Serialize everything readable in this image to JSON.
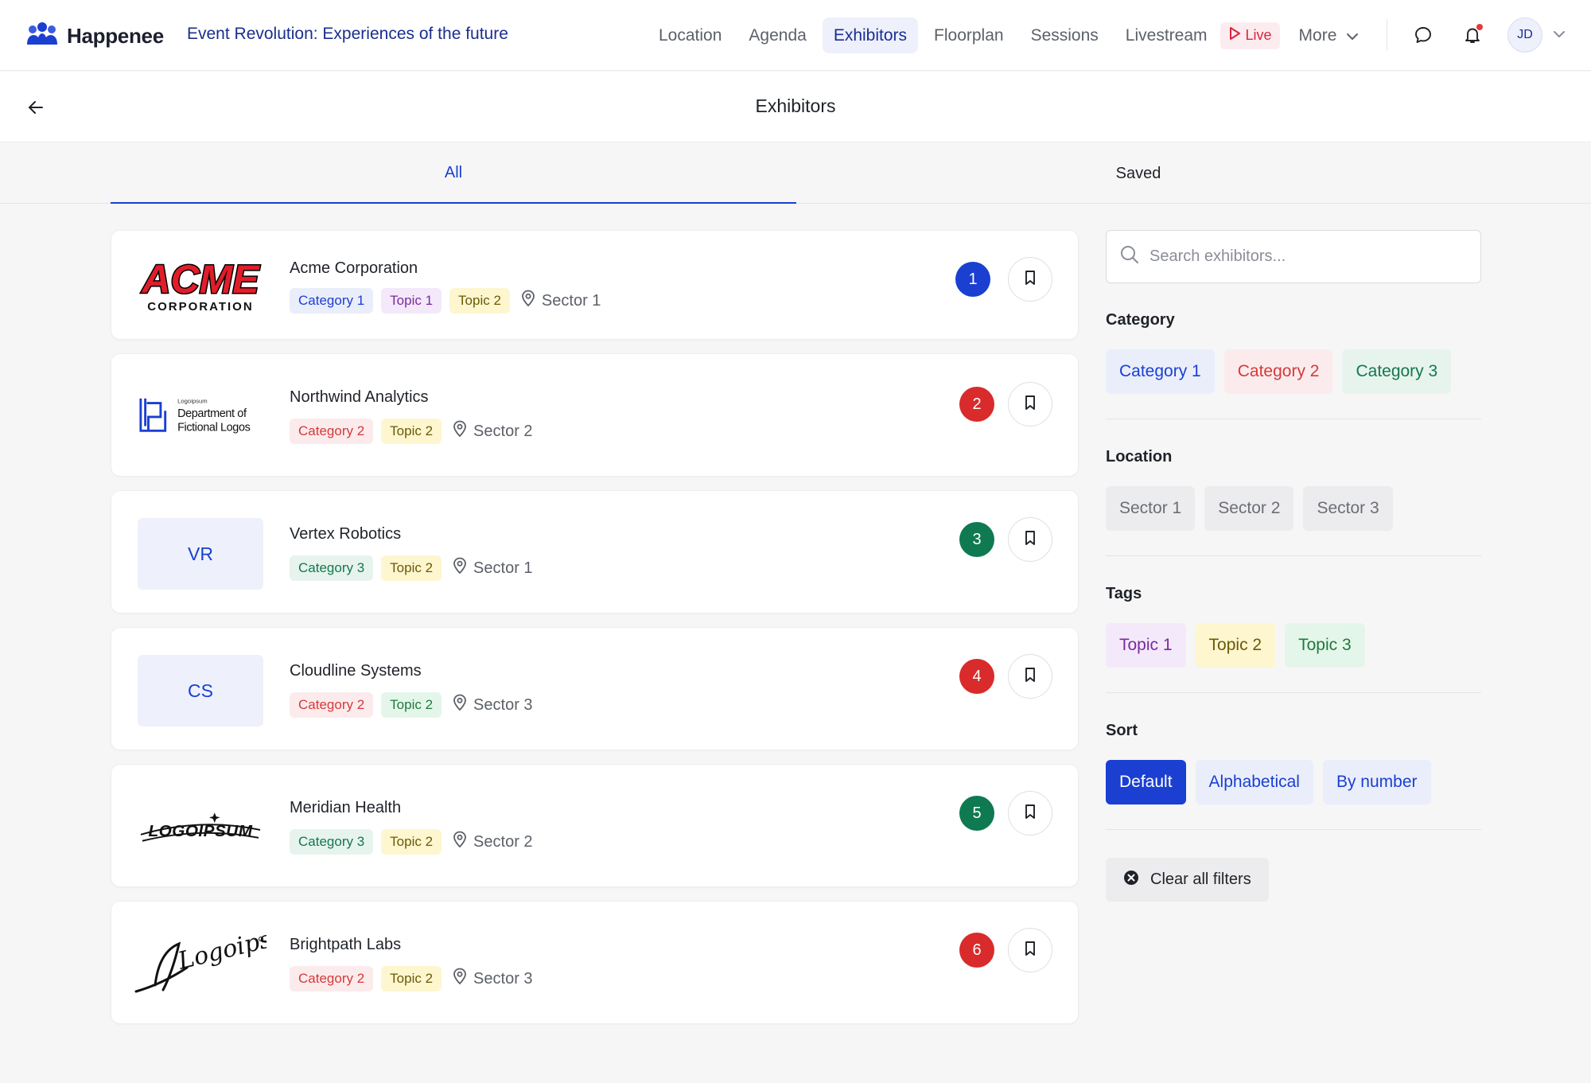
{
  "app": {
    "brand": "Happenee",
    "event_title": "Event Revolution: Experiences of the future"
  },
  "nav": {
    "items": [
      {
        "label": "Location",
        "active": false
      },
      {
        "label": "Agenda",
        "active": false
      },
      {
        "label": "Exhibitors",
        "active": true
      },
      {
        "label": "Floorplan",
        "active": false
      },
      {
        "label": "Sessions",
        "active": false
      },
      {
        "label": "Livestream",
        "active": false
      }
    ],
    "live_label": "Live",
    "more_label": "More"
  },
  "user": {
    "initials": "JD"
  },
  "page": {
    "title": "Exhibitors"
  },
  "tabs": [
    {
      "label": "All",
      "active": true
    },
    {
      "label": "Saved",
      "active": false
    }
  ],
  "exhibitors": [
    {
      "name": "Acme Corporation",
      "number": "1",
      "number_color": "#1a3fd1",
      "logo": {
        "type": "acme",
        "text_top": "ACME",
        "text_bottom": "CORPORATION"
      },
      "tags": [
        {
          "label": "Category 1",
          "kind": "cat1"
        },
        {
          "label": "Topic 1",
          "kind": "top1"
        },
        {
          "label": "Topic 2",
          "kind": "top2"
        }
      ],
      "sector": "Sector 1"
    },
    {
      "name": "Northwind Analytics",
      "number": "2",
      "number_color": "#d92b2b",
      "logo": {
        "type": "dept",
        "text_small": "Logoipsum",
        "text_line1": "Department of",
        "text_line2": "Fictional Logos"
      },
      "tags": [
        {
          "label": "Category 2",
          "kind": "cat2"
        },
        {
          "label": "Topic 2",
          "kind": "top2"
        }
      ],
      "sector": "Sector 2"
    },
    {
      "name": "Vertex Robotics",
      "number": "3",
      "number_color": "#0f7a52",
      "logo": {
        "type": "initials",
        "text": "VR"
      },
      "tags": [
        {
          "label": "Category 3",
          "kind": "cat3"
        },
        {
          "label": "Topic 2",
          "kind": "top2"
        }
      ],
      "sector": "Sector 1"
    },
    {
      "name": "Cloudline Systems",
      "number": "4",
      "number_color": "#d92b2b",
      "logo": {
        "type": "initials",
        "text": "CS"
      },
      "tags": [
        {
          "label": "Category 2",
          "kind": "cat2"
        },
        {
          "label": "Topic 2",
          "kind": "top3"
        }
      ],
      "sector": "Sector 3"
    },
    {
      "name": "Meridian Health",
      "number": "5",
      "number_color": "#0f7a52",
      "logo": {
        "type": "logoipsum",
        "text": "LOGOIPSUM"
      },
      "tags": [
        {
          "label": "Category 3",
          "kind": "cat3"
        },
        {
          "label": "Topic 2",
          "kind": "top2"
        }
      ],
      "sector": "Sector 2"
    },
    {
      "name": "Brightpath Labs",
      "number": "6",
      "number_color": "#d92b2b",
      "logo": {
        "type": "script",
        "text": "Logoipsum"
      },
      "tags": [
        {
          "label": "Category 2",
          "kind": "cat2"
        },
        {
          "label": "Topic 2",
          "kind": "top2"
        }
      ],
      "sector": "Sector 3"
    }
  ],
  "sidebar": {
    "search_placeholder": "Search exhibitors...",
    "category": {
      "title": "Category",
      "chips": [
        {
          "label": "Category 1",
          "kind": "cat1"
        },
        {
          "label": "Category 2",
          "kind": "cat2"
        },
        {
          "label": "Category 3",
          "kind": "cat3"
        }
      ]
    },
    "location": {
      "title": "Location",
      "chips": [
        {
          "label": "Sector 1",
          "kind": "loc"
        },
        {
          "label": "Sector 2",
          "kind": "loc"
        },
        {
          "label": "Sector 3",
          "kind": "loc"
        }
      ]
    },
    "tags": {
      "title": "Tags",
      "chips": [
        {
          "label": "Topic 1",
          "kind": "top1"
        },
        {
          "label": "Topic 2",
          "kind": "top2"
        },
        {
          "label": "Topic 3",
          "kind": "top3"
        }
      ]
    },
    "sort": {
      "title": "Sort",
      "chips": [
        {
          "label": "Default",
          "kind": "sort",
          "active": true
        },
        {
          "label": "Alphabetical",
          "kind": "sort",
          "active": false
        },
        {
          "label": "By number",
          "kind": "sort",
          "active": false
        }
      ]
    },
    "clear_label": "Clear all filters"
  }
}
